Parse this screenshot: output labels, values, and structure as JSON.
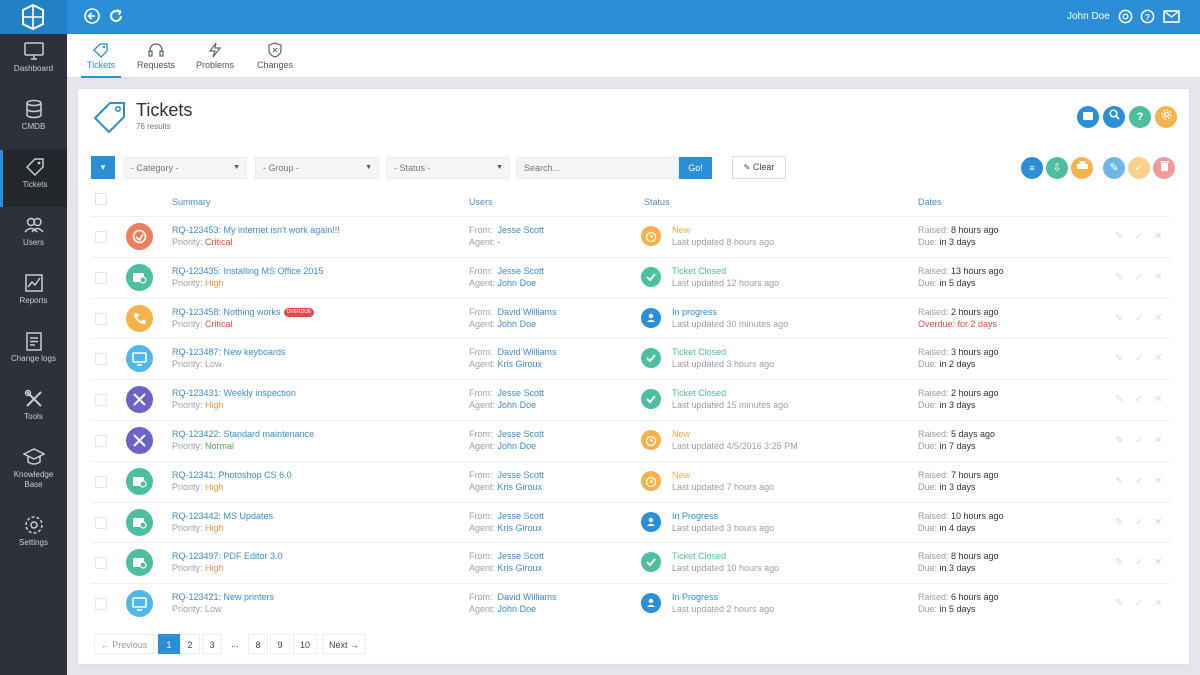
{
  "topbar": {
    "user_name": "John Doe"
  },
  "sidebar": {
    "items": [
      {
        "label": "Dashboard"
      },
      {
        "label": "CMDB"
      },
      {
        "label": "Tickets"
      },
      {
        "label": "Users"
      },
      {
        "label": "Reports"
      },
      {
        "label": "Change logs"
      },
      {
        "label": "Tools"
      },
      {
        "label": "Knowledge Base"
      },
      {
        "label": "Settings"
      }
    ]
  },
  "subnav": {
    "tabs": [
      {
        "label": "Tickets"
      },
      {
        "label": "Requests"
      },
      {
        "label": "Problems"
      },
      {
        "label": "Changes"
      }
    ]
  },
  "page": {
    "title": "Tickets",
    "result_count": "76 results"
  },
  "filters": {
    "category": "- Category -",
    "group": "- Group -",
    "status": "- Status -",
    "search_placeholder": "Search...",
    "go_label": "Go!",
    "clear_label": "Clear"
  },
  "columns": {
    "summary": "Summary",
    "users": "Users",
    "status": "Status",
    "dates": "Dates"
  },
  "labels": {
    "from": "From:",
    "agent": "Agent:",
    "priority": "Priority:",
    "raised": "Raised:",
    "due": "Due:",
    "overdue_badge": "OVERDUE"
  },
  "colors": {
    "accent": "#2a8fd6",
    "critical": "#e84c3d",
    "high": "#f2994a",
    "normal": "#4caf50",
    "low": "#9aa0a6",
    "teal": "#4dbfa0",
    "orange": "#f7b14a",
    "blue": "#2a8fd6",
    "coral": "#f07e5e",
    "purple": "#6c63c9",
    "sky": "#4fb8e8"
  },
  "tickets": [
    {
      "summary": "RQ-123453: My internet isn't work again!!!",
      "priority": "Critical",
      "from": "Jesse Scott",
      "agent": "-",
      "status": "New",
      "updated": "Last updated 8 hours ago",
      "raised": "8 hours ago",
      "due": "in 3 days",
      "overdue": false
    },
    {
      "summary": "RQ-123435: Installing MS Office 2015",
      "priority": "High",
      "from": "Jesse Scott",
      "agent": "John Doe",
      "status": "Ticket Closed",
      "updated": "Last updated 12 hours ago",
      "raised": "13 hours ago",
      "due": "in 5 days",
      "overdue": false
    },
    {
      "summary": "RQ-123458:  Nothing works",
      "priority": "Critical",
      "from": "David Williams",
      "agent": "John Doe",
      "status": "In progress",
      "updated": "Last updated 30 minutes ago",
      "raised": "2 hours ago",
      "due": "Overdue: for 2 days",
      "overdue": true
    },
    {
      "summary": "RQ-123487: New keyboards",
      "priority": "Low",
      "from": "David Williams",
      "agent": "Kris Giroux",
      "status": "Ticket Closed",
      "updated": "Last updated 3 hours ago",
      "raised": "3 hours ago",
      "due": "in 2 days",
      "overdue": false
    },
    {
      "summary": "RQ-123431: Weekly inspection",
      "priority": "High",
      "from": "Jesse Scott",
      "agent": "John Doe",
      "status": "Ticket Closed",
      "updated": "Last updated 15 minutes ago",
      "raised": "2 hours ago",
      "due": "in 3 days",
      "overdue": false
    },
    {
      "summary": "RQ-123422: Standard maintenance",
      "priority": "Normal",
      "from": "Jesse Scott",
      "agent": "John Doe",
      "status": "New",
      "updated": "Last updated 4/5/2016 3:25 PM",
      "raised": "5 days ago",
      "due": "in 7 days",
      "overdue": false
    },
    {
      "summary": "RQ-12341: Photoshop CS 6.0",
      "priority": "High",
      "from": "Jesse Scott",
      "agent": "Kris Giroux",
      "status": "New",
      "updated": "Last updated 7 hours ago",
      "raised": "7 hours ago",
      "due": "in 3 days",
      "overdue": false
    },
    {
      "summary": "RQ-123442: MS Updates",
      "priority": "High",
      "from": "Jesse Scott",
      "agent": "Kris Giroux",
      "status": "In Progress",
      "updated": "Last updated 3 hours ago",
      "raised": "10 hours ago",
      "due": "in 4 days",
      "overdue": false
    },
    {
      "summary": "RQ-123497: PDF Editor 3.0",
      "priority": "High",
      "from": "Jesse Scott",
      "agent": "Kris Giroux",
      "status": "Ticket Closed",
      "updated": "Last updated 10 hours ago",
      "raised": "8 hours ago",
      "due": "in 3 days",
      "overdue": false
    },
    {
      "summary": "RQ-123421: New printers",
      "priority": "Low",
      "from": "David Williams",
      "agent": "John Doe",
      "status": "In Progress",
      "updated": "Last updated 2 hours ago",
      "raised": "6 hours ago",
      "due": "in 5 days",
      "overdue": false
    }
  ],
  "pagination": {
    "previous": "← Previous",
    "next": "Next →",
    "pages": [
      "1",
      "2",
      "3",
      "...",
      "8",
      "9",
      "10"
    ],
    "current": "1"
  }
}
